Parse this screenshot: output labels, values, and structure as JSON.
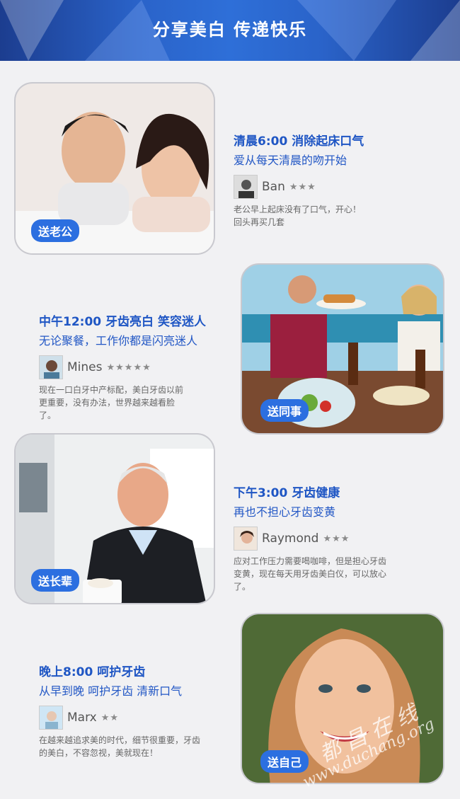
{
  "banner": {
    "title": "分享美白 传递快乐"
  },
  "sections": [
    {
      "tag": "送老公",
      "heading": "清晨6:00 消除起床口气",
      "sub": "爱从每天清晨的吻开始",
      "reviewer": {
        "name": "Ban",
        "stars": "★★★"
      },
      "review": "老公早上起床没有了口气，开心！回头再买几套"
    },
    {
      "tag": "送同事",
      "heading": "中午12:00 牙齿亮白 笑容迷人",
      "sub": "无论聚餐，工作你都是闪亮迷人",
      "reviewer": {
        "name": "Mines",
        "stars": "★★★★★"
      },
      "review": "现在一口白牙中产标配，美白牙齿以前更重要，没有办法，世界越来越看脸了。"
    },
    {
      "tag": "送长辈",
      "heading": "下午3:00 牙齿健康",
      "sub": "再也不担心牙齿变黄",
      "reviewer": {
        "name": "Raymond",
        "stars": "★★★"
      },
      "review": "应对工作压力需要喝咖啡，但是担心牙齿变黄，现在每天用牙齿美白仪，可以放心了。"
    },
    {
      "tag": "送自己",
      "heading": "晚上8:00 呵护牙齿",
      "sub": "从早到晚 呵护牙齿 清新口气",
      "reviewer": {
        "name": "Marx",
        "stars": "★★"
      },
      "review": "在越来越追求美的时代，细节很重要，牙齿的美白，不容忽视，美就现在！"
    }
  ],
  "watermark": {
    "cn": "都 昌 在 线",
    "url": "www.duchang.org"
  }
}
